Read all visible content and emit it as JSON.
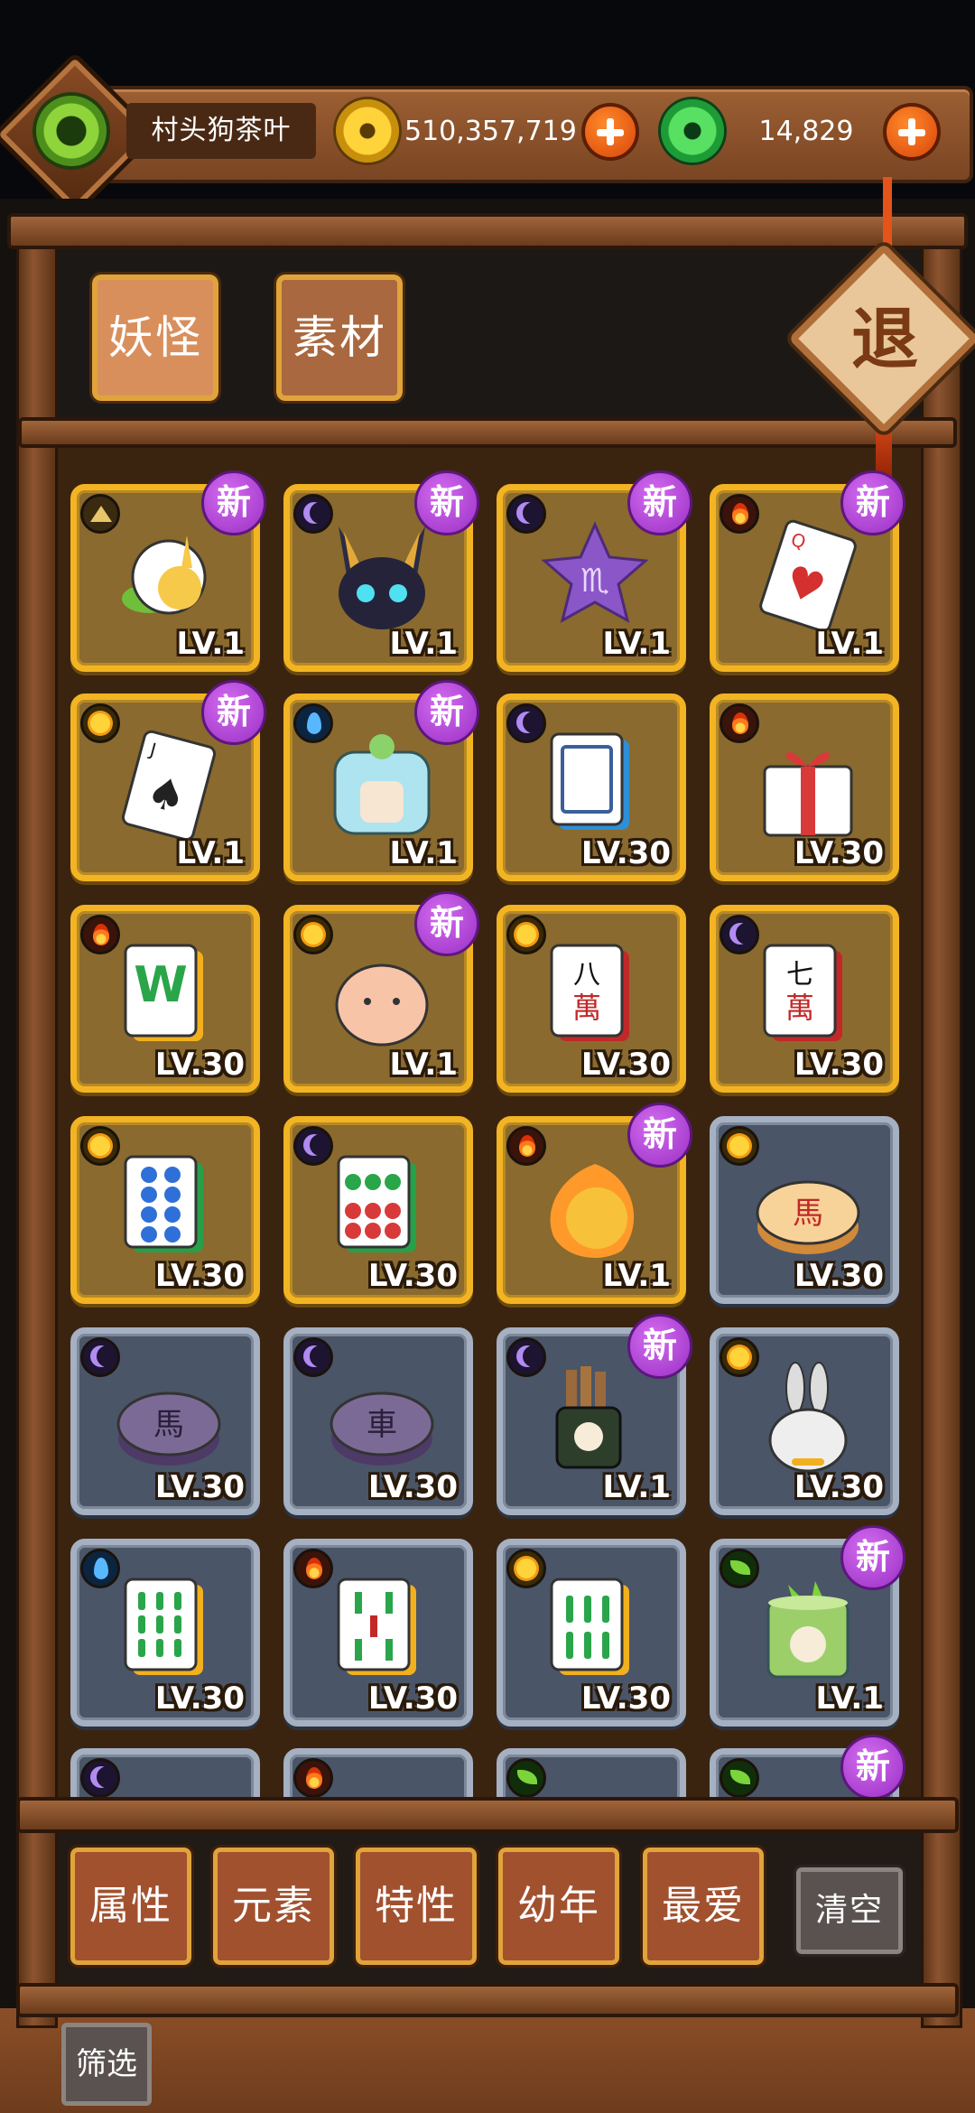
{
  "player": {
    "name": "村头狗茶叶"
  },
  "currency": {
    "gold": "510,357,719",
    "jade": "14,829"
  },
  "tabs": [
    "妖怪",
    "素材"
  ],
  "exit_label": "退",
  "new_badge": "新",
  "cards": [
    {
      "element": "earth",
      "frame": "gold",
      "is_new": true,
      "level": "LV.1",
      "art": "white-flower-creature"
    },
    {
      "element": "moon",
      "frame": "gold",
      "is_new": true,
      "level": "LV.1",
      "art": "anubis-cat"
    },
    {
      "element": "moon",
      "frame": "gold",
      "is_new": true,
      "level": "LV.1",
      "art": "scorpio-star"
    },
    {
      "element": "fire",
      "frame": "gold",
      "is_new": true,
      "level": "LV.1",
      "art": "queen-of-hearts-card"
    },
    {
      "element": "sun",
      "frame": "gold",
      "is_new": true,
      "level": "LV.1",
      "art": "jack-of-spades-card"
    },
    {
      "element": "water",
      "frame": "gold",
      "is_new": true,
      "level": "LV.1",
      "art": "jelly-block"
    },
    {
      "element": "moon",
      "frame": "gold",
      "is_new": false,
      "level": "LV.30",
      "art": "blank-mahjong-tile"
    },
    {
      "element": "fire",
      "frame": "gold",
      "is_new": false,
      "level": "LV.30",
      "art": "gift-box"
    },
    {
      "element": "fire",
      "frame": "gold",
      "is_new": false,
      "level": "LV.30",
      "art": "mahjong-w-tile"
    },
    {
      "element": "sun",
      "frame": "gold",
      "is_new": true,
      "level": "LV.1",
      "art": "pink-hamster"
    },
    {
      "element": "sun",
      "frame": "gold",
      "is_new": false,
      "level": "LV.30",
      "art": "mahjong-8-wan-tile",
      "glyph": "八\n萬"
    },
    {
      "element": "moon",
      "frame": "gold",
      "is_new": false,
      "level": "LV.30",
      "art": "mahjong-7-wan-tile",
      "glyph": "七\n萬"
    },
    {
      "element": "sun",
      "frame": "gold",
      "is_new": false,
      "level": "LV.30",
      "art": "mahjong-8-dot-tile"
    },
    {
      "element": "moon",
      "frame": "gold",
      "is_new": false,
      "level": "LV.30",
      "art": "mahjong-6-dot-tile"
    },
    {
      "element": "fire",
      "frame": "gold",
      "is_new": true,
      "level": "LV.1",
      "art": "fire-blob"
    },
    {
      "element": "sun",
      "frame": "silver",
      "is_new": false,
      "level": "LV.30",
      "art": "chess-horse-red",
      "glyph": "馬"
    },
    {
      "element": "moon",
      "frame": "silver",
      "is_new": false,
      "level": "LV.30",
      "art": "chess-horse-purple",
      "glyph": "馬"
    },
    {
      "element": "moon",
      "frame": "silver",
      "is_new": false,
      "level": "LV.30",
      "art": "chess-chariot-purple",
      "glyph": "車"
    },
    {
      "element": "moon",
      "frame": "silver",
      "is_new": true,
      "level": "LV.1",
      "art": "incense-cup"
    },
    {
      "element": "sun",
      "frame": "silver",
      "is_new": false,
      "level": "LV.30",
      "art": "bunny"
    },
    {
      "element": "water",
      "frame": "silver",
      "is_new": false,
      "level": "LV.30",
      "art": "mahjong-9-bamboo-tile"
    },
    {
      "element": "fire",
      "frame": "silver",
      "is_new": false,
      "level": "LV.30",
      "art": "mahjong-5-bamboo-tile"
    },
    {
      "element": "sun",
      "frame": "silver",
      "is_new": false,
      "level": "LV.30",
      "art": "mahjong-6-bamboo-tile"
    },
    {
      "element": "leaf",
      "frame": "silver",
      "is_new": true,
      "level": "LV.1",
      "art": "bamboo-stump"
    },
    {
      "element": "moon",
      "frame": "silver",
      "is_new": false,
      "level": "",
      "art": "partial"
    },
    {
      "element": "fire",
      "frame": "silver",
      "is_new": false,
      "level": "",
      "art": "partial"
    },
    {
      "element": "leaf",
      "frame": "silver",
      "is_new": false,
      "level": "",
      "art": "partial"
    },
    {
      "element": "leaf",
      "frame": "silver",
      "is_new": true,
      "level": "",
      "art": "partial"
    }
  ],
  "filters": [
    "属性",
    "元素",
    "特性",
    "幼年",
    "最爱"
  ],
  "clear_label": "清空",
  "filter_label": "筛选"
}
